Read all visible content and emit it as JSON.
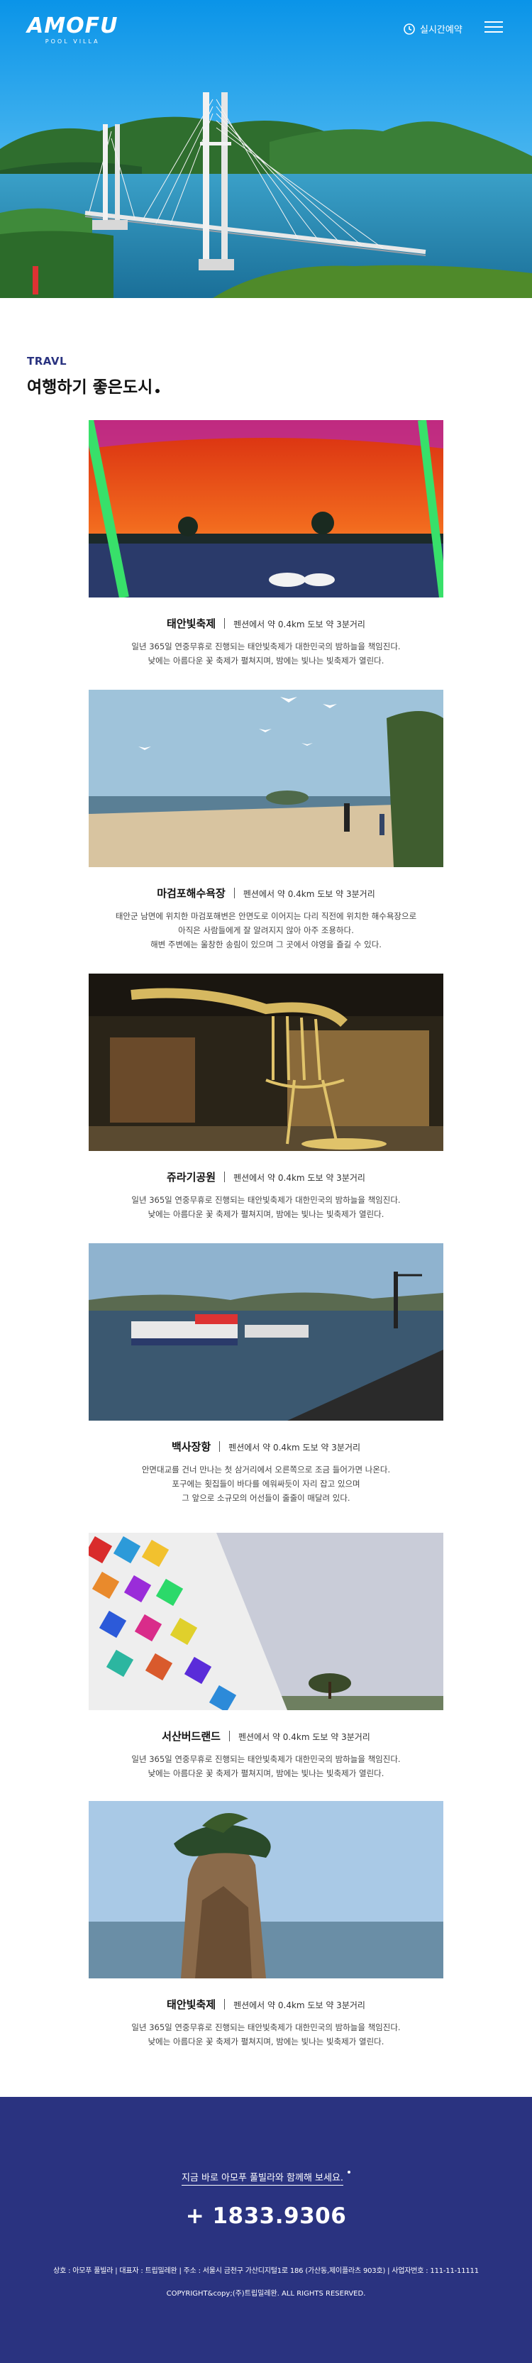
{
  "header": {
    "logo_main": "AMOFU",
    "logo_sub": "POOL VILLA",
    "reserve_label": "실시간예약",
    "reserve_icon": "clock-icon",
    "menu_icon": "hamburger-menu-icon"
  },
  "section": {
    "eyebrow": "TRAVL",
    "title": "여행하기 좋은도시"
  },
  "spots": [
    {
      "name": "태안빛축제",
      "distance": "펜션에서 약 0.4km 도보 약 3분거리",
      "desc": [
        "일년 365일 연중무휴로 진행되는 태안빛축제가 대한민국의 밤하늘을 책임진다.",
        "낮에는 아름다운 꽃 축제가 펼쳐지며, 밤에는 빛나는 빛축제가 열린다."
      ]
    },
    {
      "name": "마검포해수욕장",
      "distance": "펜션에서 약 0.4km 도보 약 3분거리",
      "desc": [
        "태안군 남면에 위치한 마검포해변은 안면도로 이어지는 다리 직전에 위치한 해수욕장으로",
        "아직은 사람들에게 잘 알려지지 않아 아주 조용하다.",
        "해변 주변에는 울창한 송림이 있으며 그 곳에서 야영을 즐길 수 있다."
      ]
    },
    {
      "name": "쥬라기공원",
      "distance": "펜션에서 약 0.4km 도보 약 3분거리",
      "desc": [
        "일년 365일 연중무휴로 진행되는 태안빛축제가 대한민국의 밤하늘을 책임진다.",
        "낮에는 아름다운 꽃 축제가 펼쳐지며, 밤에는 빛나는 빛축제가 열린다."
      ]
    },
    {
      "name": "백사장항",
      "distance": "펜션에서 약 0.4km 도보 약 3분거리",
      "desc": [
        "안면대교를 건너 만나는 첫 삼거리에서 오른쪽으로 조금 들어가면 나온다.",
        "포구에는 횟집들이 바다를 에워싸듯이 자리 잡고 있으며",
        "그 앞으로 소규모의 어선들이 줄줄이 매달려 있다."
      ]
    },
    {
      "name": "서산버드랜드",
      "distance": "펜션에서 약 0.4km 도보 약 3분거리",
      "desc": [
        "일년 365일 연중무휴로 진행되는 태안빛축제가 대한민국의 밤하늘을 책임진다.",
        "낮에는 아름다운 꽃 축제가 펼쳐지며, 밤에는 빛나는 빛축제가 열린다."
      ]
    },
    {
      "name": "태안빛축제",
      "distance": "펜션에서 약 0.4km 도보 약 3분거리",
      "desc": [
        "일년 365일 연중무휴로 진행되는 태안빛축제가 대한민국의 밤하늘을 책임진다.",
        "낮에는 아름다운 꽃 축제가 펼쳐지며, 밤에는 빛나는 빛축제가 열린다."
      ]
    }
  ],
  "footer": {
    "cta": "지금 바로 아모푸 풀빌라와 함께해 보세요.",
    "phone": "+ 1833.9306",
    "company": "상호 : 아모푸 풀빌라  |  대표자 : 트립밀레완  |  주소 : 서울시 금천구 가산디지털1로 186 (가산동,제이플라츠 903호)  |  사업자번호 : 111-11-11111",
    "copyright": "COPYRIGHT&copy;(주)트립밀레완. ALL RIGHTS RESERVED."
  },
  "colors": {
    "brand_navy": "#2a3380",
    "sky": "#1ea7e6",
    "white": "#ffffff"
  }
}
